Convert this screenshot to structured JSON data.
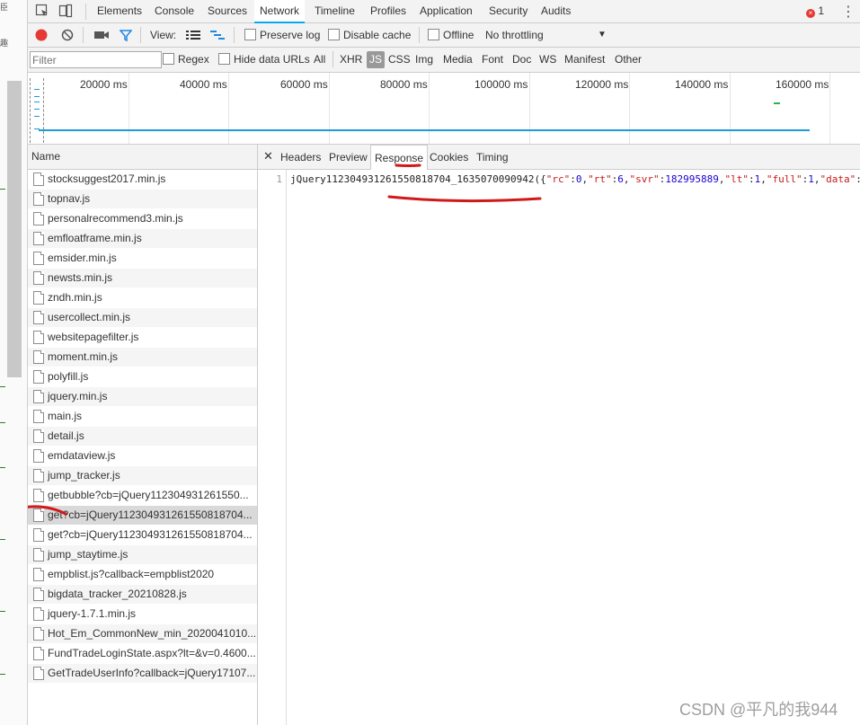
{
  "devtools": {
    "main_tabs": [
      "Elements",
      "Console",
      "Sources",
      "Network",
      "Timeline",
      "Profiles",
      "Application",
      "Security",
      "Audits"
    ],
    "active_tab": "Network",
    "error_count": "1"
  },
  "toolbar": {
    "view_label": "View:",
    "preserve_log": "Preserve log",
    "disable_cache": "Disable cache",
    "offline": "Offline",
    "throttling": "No throttling"
  },
  "filterbar": {
    "placeholder": "Filter",
    "regex": "Regex",
    "hide_data_urls": "Hide data URLs",
    "types": [
      "All",
      "XHR",
      "JS",
      "CSS",
      "Img",
      "Media",
      "Font",
      "Doc",
      "WS",
      "Manifest",
      "Other"
    ],
    "active_type": "JS"
  },
  "overview": {
    "labels": [
      "20000 ms",
      "40000 ms",
      "60000 ms",
      "80000 ms",
      "100000 ms",
      "120000 ms",
      "140000 ms",
      "160000 ms"
    ]
  },
  "requests": {
    "header": "Name",
    "items": [
      "stocksuggest2017.min.js",
      "topnav.js",
      "personalrecommend3.min.js",
      "emfloatframe.min.js",
      "emsider.min.js",
      "newsts.min.js",
      "zndh.min.js",
      "usercollect.min.js",
      "websitepagefilter.js",
      "moment.min.js",
      "polyfill.js",
      "jquery.min.js",
      "main.js",
      "detail.js",
      "emdataview.js",
      "jump_tracker.js",
      "getbubble?cb=jQuery112304931261550...",
      "get?cb=jQuery1123049312615508187​04...",
      "get?cb=jQuery1123049312615508187​04...",
      "jump_staytime.js",
      "empblist.js?callback=empblist2020",
      "bigdata_tracker_20210828.js",
      "jquery-1.7.1.min.js",
      "Hot_Em_CommonNew_min_2020041010...",
      "FundTradeLoginState.aspx?lt=&v=0.4600...",
      "GetTradeUserInfo?callback=jQuery17107..."
    ],
    "selected_index": 17
  },
  "detail": {
    "tabs": [
      "Headers",
      "Preview",
      "Response",
      "Cookies",
      "Timing"
    ],
    "active_tab": "Response",
    "line_number": "1",
    "callback": "jQuery1123049312615508187​04_1635070090942",
    "open": "({",
    "pairs": [
      {
        "k": "\"rc\"",
        "v": "0",
        "type": "n"
      },
      {
        "k": "\"rt\"",
        "v": "6",
        "type": "n"
      },
      {
        "k": "\"svr\"",
        "v": "182995889",
        "type": "n"
      },
      {
        "k": "\"lt\"",
        "v": "1",
        "type": "n"
      },
      {
        "k": "\"full\"",
        "v": "1",
        "type": "n"
      },
      {
        "k": "\"data\"",
        "v": "",
        "type": "n"
      }
    ]
  },
  "watermark": "CSDN @平凡的我944"
}
